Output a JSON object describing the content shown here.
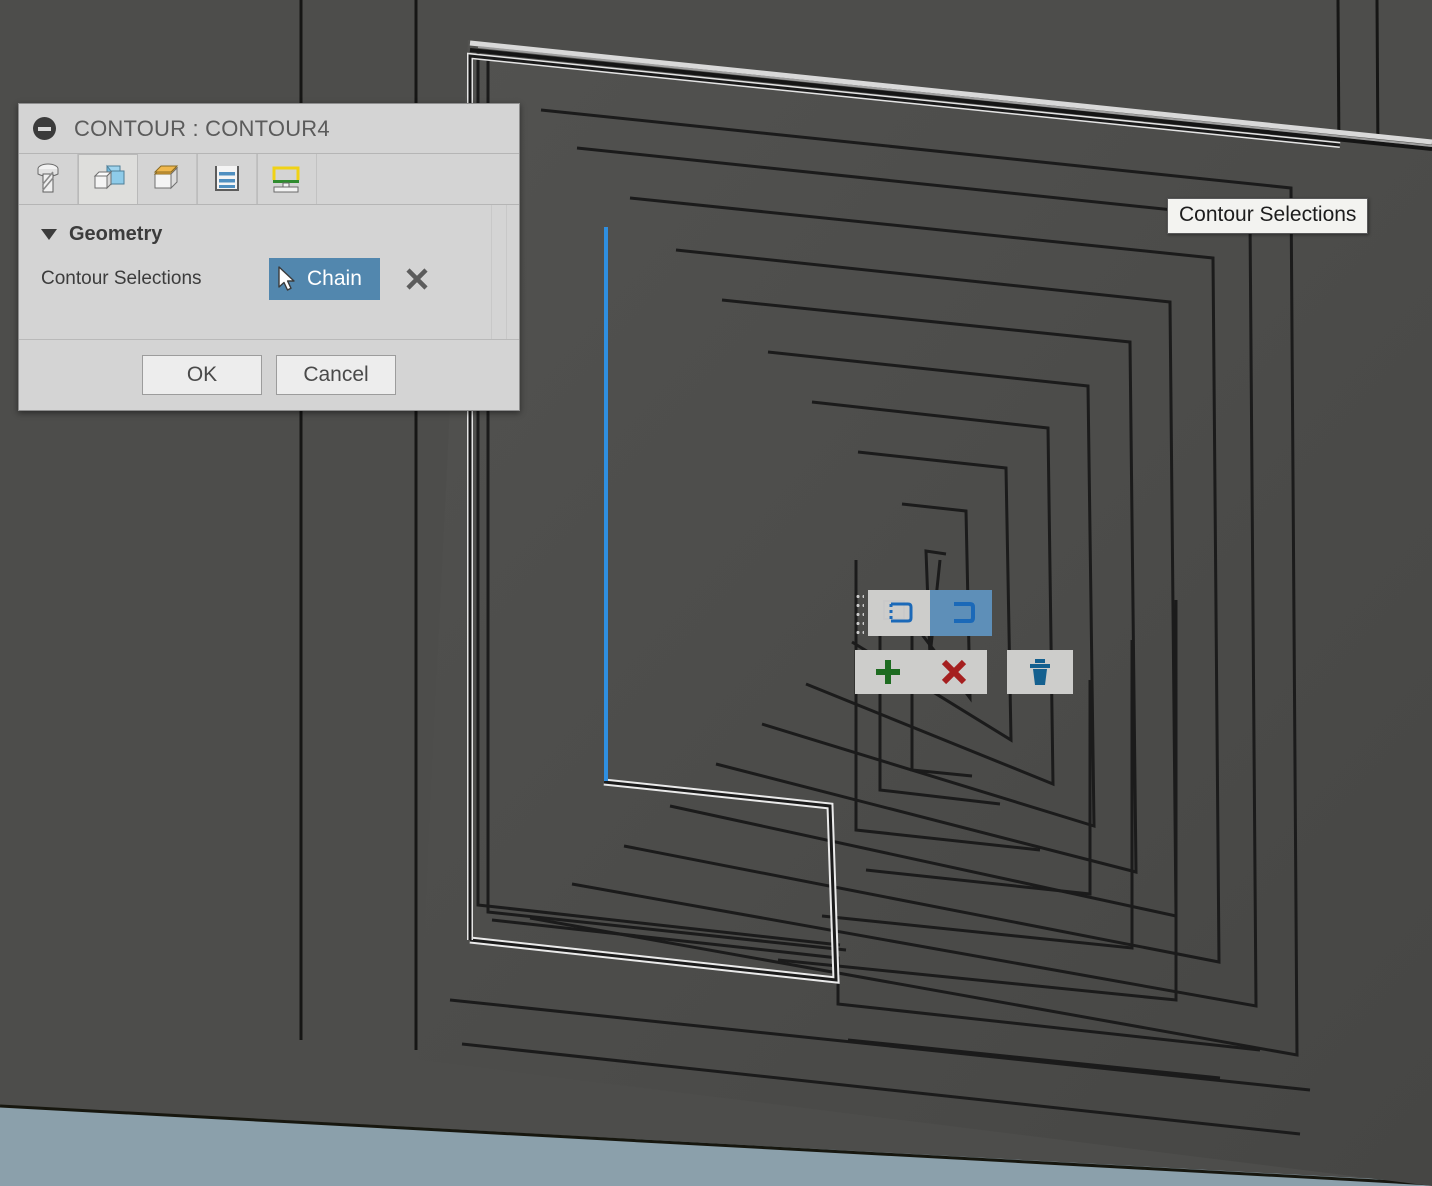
{
  "viewport": {
    "name": "cam-3d-viewport",
    "background_color": "#4d4d4b",
    "part_face_color": "#4a4a48",
    "pocket_floor_color": "#565654",
    "edge_color": "#1a1a1a",
    "stock_floor_color": "#8ba0ab",
    "highlight_chain_color": "#f0f0f0",
    "selected_edge_color": "#2f8fe0",
    "description": "Isometric view of a machined square plate containing a nested rectangular spiral (maze) pocket pattern"
  },
  "dialog": {
    "title": "CONTOUR : CONTOUR4",
    "collapse_icon": "minus-circle-icon",
    "tabs": [
      {
        "name": "tool-tab",
        "icon": "endmill-tool-icon",
        "active": false
      },
      {
        "name": "geometry-tab",
        "icon": "geometry-cubes-icon",
        "active": true
      },
      {
        "name": "heights-tab",
        "icon": "heights-box-icon",
        "active": false
      },
      {
        "name": "passes-tab",
        "icon": "passes-icon",
        "active": false
      },
      {
        "name": "linking-tab",
        "icon": "linking-icon",
        "active": false
      }
    ],
    "group": {
      "name": "Geometry",
      "expanded": true,
      "caret_icon": "caret-down-icon"
    },
    "contour_row": {
      "label": "Contour Selections",
      "value": "Chain",
      "cursor_icon": "mouse-pointer-icon",
      "clear_icon": "close-x-icon",
      "value_bg_color": "#5287ae"
    },
    "footer": {
      "ok_label": "OK",
      "cancel_label": "Cancel"
    }
  },
  "tooltip": {
    "text": "Contour Selections"
  },
  "floating_toolbar": {
    "drag_handle_icon": "drag-dots-icon",
    "toggles": [
      {
        "name": "closed-contour-toggle",
        "icon": "closed-contour-icon",
        "active": false
      },
      {
        "name": "open-contour-toggle",
        "icon": "open-contour-icon",
        "active": true
      }
    ],
    "actions": [
      {
        "name": "add-selection-button",
        "icon": "plus-icon",
        "color": "#1d6b20"
      },
      {
        "name": "remove-selection-button",
        "icon": "red-x-icon",
        "color": "#a51f1f"
      },
      {
        "name": "delete-selection-button",
        "icon": "trash-icon",
        "color": "#14608f"
      }
    ]
  }
}
